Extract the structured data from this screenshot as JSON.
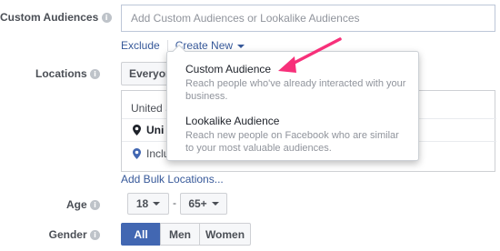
{
  "custom_audiences": {
    "label": "Custom Audiences",
    "placeholder": "Add Custom Audiences or Lookalike Audiences",
    "exclude_label": "Exclude",
    "create_new_label": "Create New"
  },
  "locations": {
    "label": "Locations",
    "selector_value": "Everyone",
    "panel_text": "United S",
    "country_text": "Uni",
    "include_text": "Includ",
    "bulk_link": "Add Bulk Locations..."
  },
  "dropdown": {
    "items": [
      {
        "title": "Custom Audience",
        "description": "Reach people who've already interacted with your business."
      },
      {
        "title": "Lookalike Audience",
        "description": "Reach new people on Facebook who are similar to your most valuable audiences."
      }
    ]
  },
  "age": {
    "label": "Age",
    "min": "18",
    "separator": "-",
    "max": "65+"
  },
  "gender": {
    "label": "Gender",
    "options": [
      "All",
      "Men",
      "Women"
    ],
    "selected": "All"
  },
  "colors": {
    "link": "#365899",
    "accent": "#4267b2",
    "arrow": "#f7307a"
  }
}
